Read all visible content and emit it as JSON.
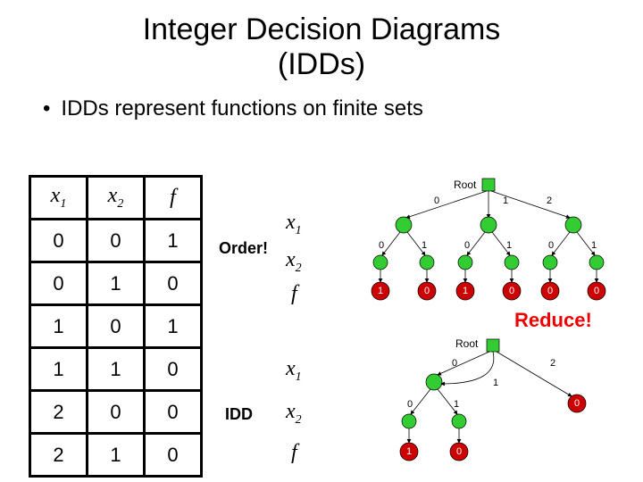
{
  "title_line1": "Integer Decision Diagrams",
  "title_line2": "(IDDs)",
  "bullet": "IDDs represent functions on finite sets",
  "table": {
    "headers": [
      "x",
      "1",
      "x",
      "2",
      "f"
    ],
    "rows": [
      [
        "0",
        "0",
        "1"
      ],
      [
        "0",
        "1",
        "0"
      ],
      [
        "1",
        "0",
        "1"
      ],
      [
        "1",
        "1",
        "0"
      ],
      [
        "2",
        "0",
        "0"
      ],
      [
        "2",
        "1",
        "0"
      ]
    ]
  },
  "order_label": "Order!",
  "idd_label": "IDD",
  "reduce_label": "Reduce!",
  "root_label_top": "Root",
  "root_label_bottom": "Root",
  "var_labels": {
    "x1_a": "x",
    "x1_a_sub": "1",
    "x2_a": "x",
    "x2_a_sub": "2",
    "f_a": "f",
    "x1_b": "x",
    "x1_b_sub": "1",
    "x2_b": "x",
    "x2_b_sub": "2",
    "f_b": "f"
  },
  "top_tree": {
    "root_edges": [
      "0",
      "1",
      "2"
    ],
    "mid_edges_left": [
      "0",
      "1"
    ],
    "mid_edges_center": [
      "0",
      "1"
    ],
    "mid_edges_right": [
      "0",
      "1"
    ],
    "leaves": [
      "1",
      "0",
      "1",
      "0",
      "0",
      "0"
    ]
  },
  "bottom_tree": {
    "root_edges": [
      "0",
      "2"
    ],
    "mid_edge_note": "1",
    "mid_edges": [
      "0",
      "1"
    ],
    "leaves": [
      "1",
      "0"
    ],
    "far_leaf": "0"
  }
}
